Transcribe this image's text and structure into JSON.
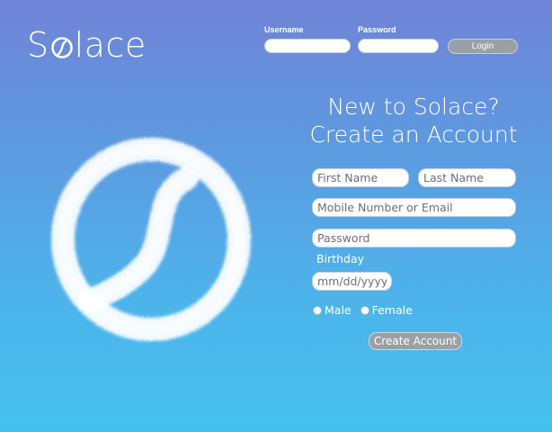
{
  "brand": {
    "name_prefix": "S",
    "name_suffix": "lace",
    "logo_icon": "solace-o-swirl-icon"
  },
  "login_bar": {
    "username_label": "Username",
    "password_label": "Password",
    "username_value": "",
    "password_value": "",
    "login_label": "Login"
  },
  "signup": {
    "headline_line1": "New to Solace?",
    "headline_line2": "Create an Account",
    "first_name_placeholder": "First Name",
    "last_name_placeholder": "Last Name",
    "contact_placeholder": "Mobile Number or Email",
    "password_placeholder": "Password",
    "birthday_label": "Birthday",
    "birthday_placeholder": "mm/dd/yyyy",
    "gender_options": [
      "Male",
      "Female"
    ],
    "create_label": "Create Account"
  },
  "hero": {
    "icon": "cloud-swirl-icon"
  },
  "colors": {
    "gradient_top": "#7183d6",
    "gradient_bottom": "#45c1ee",
    "button_gray": "#9aa0a8"
  }
}
